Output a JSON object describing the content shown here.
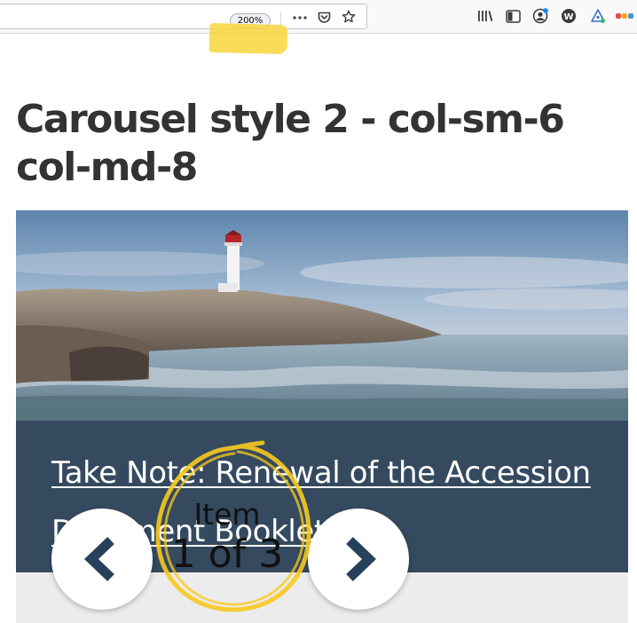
{
  "browser": {
    "zoom_level": "200%",
    "icons": [
      "more-actions-icon",
      "pocket-icon",
      "bookmark-star-icon",
      "library-icon",
      "sidebar-icon",
      "account-icon",
      "wappalyzer-icon",
      "extension-icon",
      "color-extension-icon"
    ]
  },
  "page": {
    "title": "Carousel style 2 - col-sm-6 col-md-8"
  },
  "carousel": {
    "caption_link": "Take Note: Renewal of the Accession Document Booklet.",
    "counter_label": "Item",
    "counter_value": "1 of 3",
    "prev_icon": "chevron-left-icon",
    "next_icon": "chevron-right-icon"
  },
  "colors": {
    "caption_bg": "#354a5f",
    "nav_chevron": "#27405c",
    "annotation_yellow": "#f8c91e",
    "strip_bg": "#ececec"
  }
}
